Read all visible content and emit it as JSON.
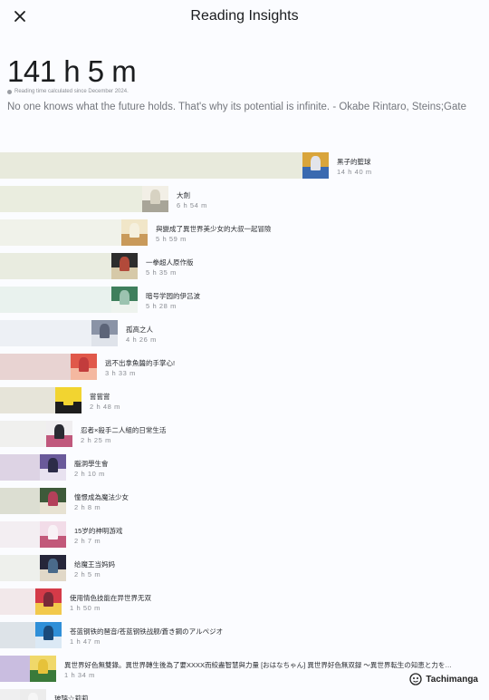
{
  "header": {
    "title": "Reading Insights",
    "close_icon": "close-icon"
  },
  "summary": {
    "total": "141 h 5 m",
    "since": "Reading time calculated since December 2024.",
    "quote": "No one knows what the future holds. That's why its potential is infinite. - Okabe Rintaro, Steins;Gate"
  },
  "manga": [
    {
      "title": "黑子的籃球",
      "time": "14 h 40 m",
      "bar_color": "#e8eadc",
      "cover_colors": [
        "#d9a53a",
        "#3a6ab0",
        "#e2e4ea"
      ]
    },
    {
      "title": "大劍",
      "time": "6 h 54 m",
      "bar_color": "#eaeddf",
      "cover_colors": [
        "#f2efe6",
        "#a8a598",
        "#d7d2c2"
      ]
    },
    {
      "title": "與變成了異世界美少女的大叔一起冒險",
      "time": "5 h 59 m",
      "bar_color": "#f0f2ea",
      "cover_colors": [
        "#f1e6c8",
        "#c99a5a",
        "#f5f0de"
      ]
    },
    {
      "title": "一拳超人原作版",
      "time": "5 h 35 m",
      "bar_color": "#e9ece0",
      "cover_colors": [
        "#2d2d2d",
        "#d6c9a8",
        "#b24a3a"
      ]
    },
    {
      "title": "暗号学园的伊吕波",
      "time": "5 h 28 m",
      "bar_color": "#e9f2ee",
      "cover_colors": [
        "#3f7f5c",
        "#eef3ee",
        "#9cc3b0"
      ]
    },
    {
      "title": "孤高之人",
      "time": "4 h 26 m",
      "bar_color": "#edf0f5",
      "cover_colors": [
        "#8a93a6",
        "#dfe3ea",
        "#5c6478"
      ]
    },
    {
      "title": "逃不出拿魚醬的手掌心!",
      "time": "3 h 33 m",
      "bar_color": "#e8d3d2",
      "cover_colors": [
        "#e0584a",
        "#f4b8a0",
        "#c23c3c"
      ]
    },
    {
      "title": "嘗嘗嘗",
      "time": "2 h 48 m",
      "bar_color": "#e6e4d9",
      "cover_colors": [
        "#f2d430",
        "#1d1d1d",
        "#f2d430"
      ]
    },
    {
      "title": "忍者×殺手二人組的日常生活",
      "time": "2 h 25 m",
      "bar_color": "#f0f0ee",
      "cover_colors": [
        "#f0eef0",
        "#c0587c",
        "#2a2a32"
      ]
    },
    {
      "title": "腦洞學生會",
      "time": "2 h 10 m",
      "bar_color": "#ddd3e4",
      "cover_colors": [
        "#6a5a9a",
        "#e8e2f0",
        "#2c2c48"
      ]
    },
    {
      "title": "憧憬成為魔法少女",
      "time": "2 h 8 m",
      "bar_color": "#dcded2",
      "cover_colors": [
        "#3e5a3a",
        "#e7e2d2",
        "#b3405a"
      ]
    },
    {
      "title": "15岁的神明游戏",
      "time": "2 h 7 m",
      "bar_color": "#f3eef2",
      "cover_colors": [
        "#f2dce8",
        "#c2587a",
        "#f8f2f6"
      ]
    },
    {
      "title": "给魔王当妈妈",
      "time": "2 h 5 m",
      "bar_color": "#eef0ec",
      "cover_colors": [
        "#26263a",
        "#e1d8c8",
        "#4a6a8a"
      ]
    },
    {
      "title": "使用情色技能在异世界无双",
      "time": "1 h 50 m",
      "bar_color": "#f2e8ea",
      "cover_colors": [
        "#d43a48",
        "#f2c94c",
        "#7a2a38"
      ]
    },
    {
      "title": "苍蓝钢铁的琶音/苍蓝钢铁战舰/蒼き鋼のアルペジオ",
      "time": "1 h 47 m",
      "bar_color": "#dde3e8",
      "cover_colors": [
        "#2f8fd8",
        "#dbe9f5",
        "#1a4a7a"
      ]
    },
    {
      "title": "異世界好色無雙錄。異世界轉生後為了要XXXX而絞盡智慧與力量 [おはなちゃん] 異世界好色無双録 ～異世界転生の知恵と力を…",
      "time": "1 h 34 m",
      "bar_color": "#c9bde0",
      "cover_colors": [
        "#f0d86a",
        "#3a7a3a",
        "#e6c23a"
      ]
    },
    {
      "title": "玻璃☆莉莉",
      "time": "",
      "bar_color": "#efeff0",
      "cover_colors": [
        "#ececec",
        "#8a8a8a",
        "#f6f6f6"
      ]
    }
  ],
  "brand": {
    "name": "Tachimanga",
    "icon": "tachimanga-logo-icon"
  }
}
